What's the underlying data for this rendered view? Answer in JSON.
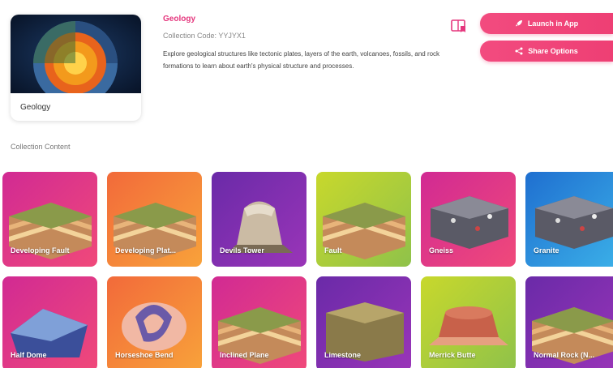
{
  "collection": {
    "thumbnail_label": "Geology",
    "subject": "Geology",
    "code": "Collection Code: YYJYX1",
    "description": "Explore geological structures like tectonic plates, layers of the earth, volcanoes, fossils, and rock formations to learn about earth's physical structure and processes."
  },
  "actions": {
    "launch_label": "Launch in App",
    "share_label": "Share Options",
    "launch_icon": "rocket-icon",
    "share_icon": "share-icon",
    "bookmark_icon": "bookmark-icon"
  },
  "section": {
    "title": "Collection Content"
  },
  "tiles": [
    {
      "label": "Developing Fault",
      "theme": "pink"
    },
    {
      "label": "Developing Plat...",
      "theme": "orange"
    },
    {
      "label": "Devils Tower",
      "theme": "purple"
    },
    {
      "label": "Fault",
      "theme": "lime"
    },
    {
      "label": "Gneiss",
      "theme": "pink"
    },
    {
      "label": "Granite",
      "theme": "blue"
    },
    {
      "label": "Half Dome",
      "theme": "pink"
    },
    {
      "label": "Horseshoe Bend",
      "theme": "orange"
    },
    {
      "label": "Inclined Plane",
      "theme": "pink"
    },
    {
      "label": "Limestone",
      "theme": "purple"
    },
    {
      "label": "Merrick Butte",
      "theme": "lime"
    },
    {
      "label": "Normal Rock (N...",
      "theme": "purple"
    }
  ],
  "colors": {
    "accent": "#ee3f74",
    "pink": "#e2338d",
    "orange": "#f5842f",
    "purple": "#7a2fa8",
    "lime": "#a9c93a",
    "blue": "#2e8fd8"
  }
}
